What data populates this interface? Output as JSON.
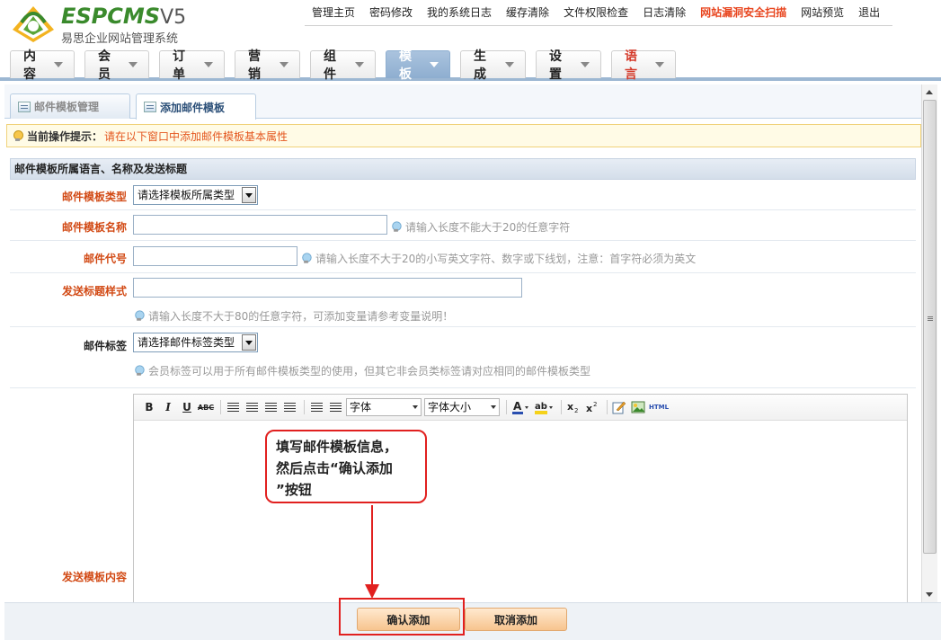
{
  "brand": {
    "logo_text": "ESPCMS",
    "logo_version": "V5",
    "subtitle": "易思企业网站管理系统"
  },
  "top_links": [
    "管理主页",
    "密码修改",
    "我的系统日志",
    "缓存清除",
    "文件权限检查",
    "日志清除",
    "网站漏洞安全扫描",
    "网站预览",
    "退出"
  ],
  "main_nav": [
    {
      "label": "内容"
    },
    {
      "label": "会员"
    },
    {
      "label": "订单"
    },
    {
      "label": "营销"
    },
    {
      "label": "组件"
    },
    {
      "label": "模板",
      "active": true
    },
    {
      "label": "生成"
    },
    {
      "label": "设置"
    },
    {
      "label": "语言"
    }
  ],
  "sub_tabs": [
    {
      "label": "邮件模板管理"
    },
    {
      "label": "添加邮件模板",
      "active": true
    }
  ],
  "tip": {
    "label": "当前操作提示：",
    "text": "请在以下窗口中添加邮件模板基本属性"
  },
  "form": {
    "section_title": "邮件模板所属语言、名称及发送标题",
    "type_label": "邮件模板类型",
    "type_value": "请选择模板所属类型",
    "name_label": "邮件模板名称",
    "name_hint": "请输入长度不能大于20的任意字符",
    "code_label": "邮件代号",
    "code_hint": "请输入长度不大于20的小写英文字符、数字或下线划，注意：首字符必须为英文",
    "subject_label": "发送标题样式",
    "subject_hint": "请输入长度不大于80的任意字符，可添加变量请参考变量说明！",
    "tag_label": "邮件标签",
    "tag_value": "请选择邮件标签类型",
    "tag_hint": "会员标签可以用于所有邮件模板类型的使用，但其它非会员类标签请对应相同的邮件模板类型",
    "content_label": "发送模板内容"
  },
  "editor": {
    "font_family": "字体",
    "font_size": "字体大小"
  },
  "callout": {
    "line1": "填写邮件模板信息，",
    "line2": "然后点击“确认添加",
    "line3": "”按钮"
  },
  "buttons": {
    "confirm": "确认添加",
    "cancel": "取消添加"
  },
  "colors": {
    "accent_red": "#e1201f",
    "label_orange": "#d24a15",
    "nav_active": "#8eaed0",
    "button_orange": "#f7c48e"
  }
}
